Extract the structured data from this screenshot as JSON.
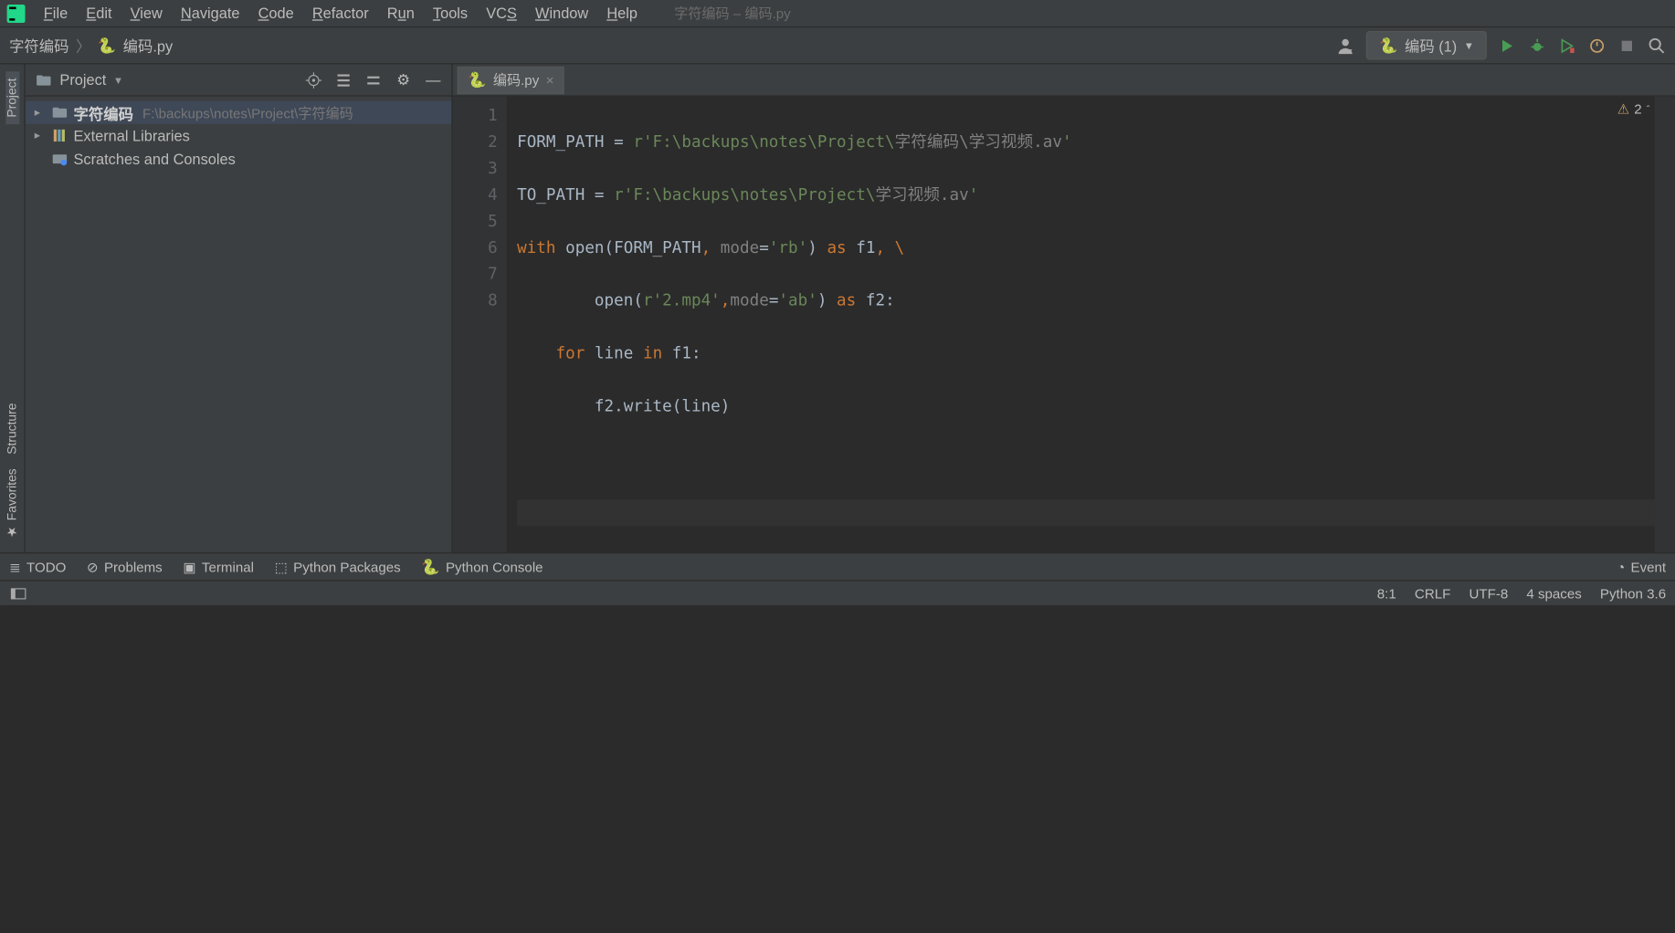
{
  "window_title": "字符编码 – 编码.py",
  "menu": [
    "File",
    "Edit",
    "View",
    "Navigate",
    "Code",
    "Refactor",
    "Run",
    "Tools",
    "VCS",
    "Window",
    "Help"
  ],
  "breadcrumb": {
    "root": "字符编码",
    "file": "编码.py"
  },
  "run_config": {
    "label": "编码 (1)"
  },
  "project_panel": {
    "title": "Project",
    "root": {
      "name": "字符编码",
      "path": "F:\\backups\\notes\\Project\\字符编码"
    },
    "external": "External Libraries",
    "scratches": "Scratches and Consoles"
  },
  "sidebar_left": {
    "project": "Project",
    "structure": "Structure",
    "favorites": "Favorites"
  },
  "editor_tab": {
    "name": "编码.py"
  },
  "warnings": {
    "count": "2"
  },
  "code": {
    "l1a": "FORM_PATH = ",
    "l1b": "r'F:\\backups\\notes\\Project\\",
    "l1c": "字符编码\\学习视频.av",
    "l1d": "'",
    "l2a": "TO_PATH = ",
    "l2b": "r'F:\\backups\\notes\\Project\\",
    "l2c": "学习视频.av",
    "l2d": "'",
    "l3a": "with",
    "l3b": " open(FORM_PATH",
    "l3c": ", ",
    "l3d": "mode",
    "l3e": "=",
    "l3f": "'rb'",
    "l3g": ") ",
    "l3h": "as",
    "l3i": " f1",
    "l3j": ", \\",
    "l4a": "        open(",
    "l4b": "r'2.mp4'",
    "l4c": ",",
    "l4d": "mode",
    "l4e": "=",
    "l4f": "'ab'",
    "l4g": ") ",
    "l4h": "as",
    "l4i": " f2:",
    "l5a": "    ",
    "l5b": "for",
    "l5c": " line ",
    "l5d": "in",
    "l5e": " f1:",
    "l6a": "        f2.write(line)"
  },
  "gutter_lines": [
    "1",
    "2",
    "3",
    "4",
    "5",
    "6",
    "7",
    "8"
  ],
  "bottom": {
    "todo": "TODO",
    "problems": "Problems",
    "terminal": "Terminal",
    "packages": "Python Packages",
    "console": "Python Console",
    "eventlog": "Event"
  },
  "status": {
    "pos": "8:1",
    "eol": "CRLF",
    "encoding": "UTF-8",
    "indent": "4 spaces",
    "interpreter": "Python 3.6"
  }
}
